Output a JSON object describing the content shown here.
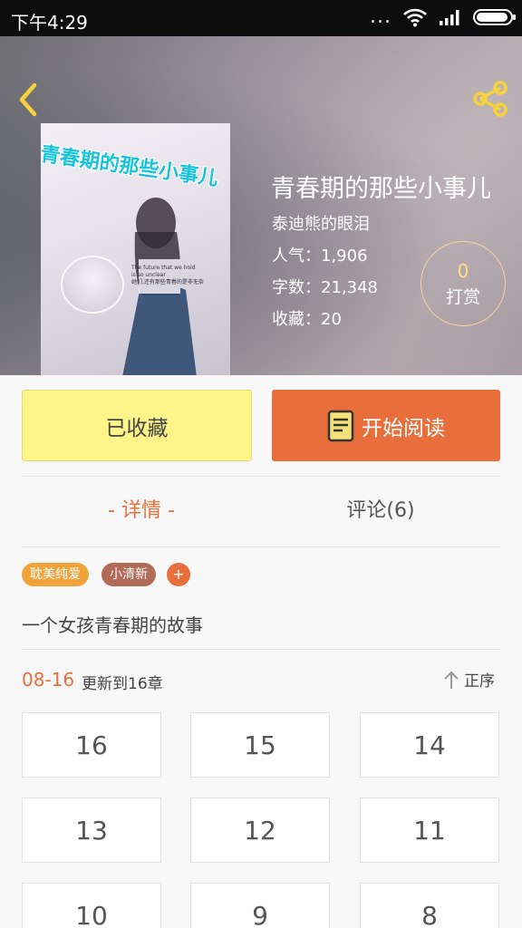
{
  "status_bar": {
    "time": "下午4:29",
    "dots": "..."
  },
  "book": {
    "cover_title": "青春期的那些小事儿",
    "cover_caption_1": "The future that we hold",
    "cover_caption_2": "is so unclear",
    "cover_caption_3": "她们,还有那些青春的是非无奈",
    "title": "青春期的那些小事儿",
    "author": "泰迪熊的眼泪",
    "popularity": "人气：1,906",
    "word_count": "字数：21,348",
    "favorites": "收藏：20",
    "tip_count": "0",
    "tip_label": "打赏"
  },
  "actions": {
    "favorited_label": "已收藏",
    "read_label": "开始阅读"
  },
  "tabs": {
    "detail": "- 详情 -",
    "comments": "评论(6)"
  },
  "tags": [
    "耽美纯爱",
    "小清新"
  ],
  "tag_add": "+",
  "summary": "一个女孩青春期的故事",
  "update": {
    "date": "08-16",
    "text": "更新到16章",
    "sort_label": "正序"
  },
  "chapters": [
    "16",
    "15",
    "14",
    "13",
    "12",
    "11",
    "10",
    "9",
    "8"
  ],
  "colors": {
    "accent": "#e86f3c",
    "fav_button": "#fef488",
    "tag_yellow": "#f0a23b",
    "tag_brown": "#b26b57"
  },
  "icons": [
    "back-arrow-icon",
    "share-icon",
    "wifi-icon",
    "signal-icon",
    "battery-icon",
    "book-icon",
    "sort-up-arrow-icon"
  ]
}
